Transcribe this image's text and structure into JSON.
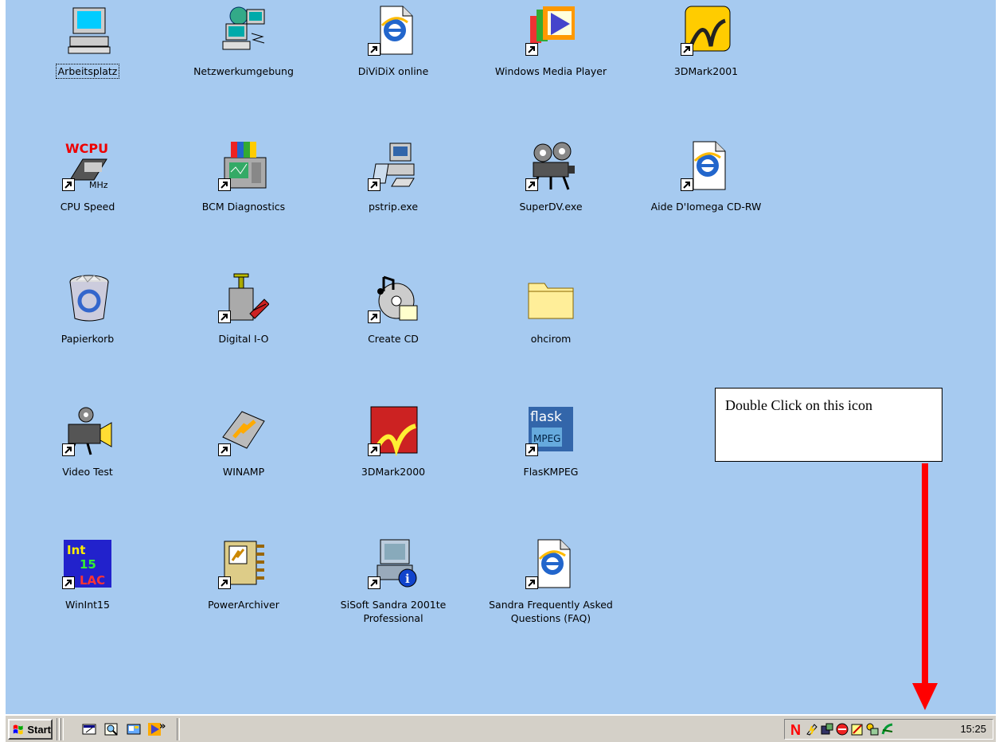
{
  "desktop": {
    "background": "#a6caf0",
    "icons": [
      {
        "label": "Arbeitsplatz",
        "icon": "my-computer-icon",
        "shortcut": false,
        "selected": true
      },
      {
        "label": "Netzwerkumgebung",
        "icon": "network-neighborhood-icon",
        "shortcut": false
      },
      {
        "label": "DiViDiX online",
        "icon": "internet-explorer-document-icon",
        "shortcut": true
      },
      {
        "label": "Windows Media Player",
        "icon": "media-player-icon",
        "shortcut": true
      },
      {
        "label": "3DMark2001",
        "icon": "3dmark2001-icon",
        "shortcut": true
      },
      {
        "label": "CPU Speed",
        "icon": "wcpu-icon",
        "shortcut": true
      },
      {
        "label": "BCM Diagnostics",
        "icon": "bcm-diagnostics-icon",
        "shortcut": true
      },
      {
        "label": "pstrip.exe",
        "icon": "pstrip-computer-icon",
        "shortcut": true
      },
      {
        "label": "SuperDV.exe",
        "icon": "film-projector-icon",
        "shortcut": true
      },
      {
        "label": "Aide D'Iomega CD-RW",
        "icon": "internet-explorer-document-icon",
        "shortcut": true
      },
      {
        "label": "Papierkorb",
        "icon": "recycle-bin-icon",
        "shortcut": false
      },
      {
        "label": "Digital I-O",
        "icon": "dynamite-plunger-icon",
        "shortcut": true
      },
      {
        "label": "Create CD",
        "icon": "cd-music-icon",
        "shortcut": true
      },
      {
        "label": "ohcirom",
        "icon": "folder-icon",
        "shortcut": false
      },
      {
        "label": "Video Test",
        "icon": "video-camera-icon",
        "shortcut": true
      },
      {
        "label": "WINAMP",
        "icon": "winamp-bolt-icon",
        "shortcut": true
      },
      {
        "label": "3DMark2000",
        "icon": "3dmark2000-icon",
        "shortcut": true
      },
      {
        "label": "FlasKMPEG",
        "icon": "flask-mpeg-icon",
        "shortcut": true
      },
      {
        "label": "WinInt15",
        "icon": "winint15-icon",
        "shortcut": true
      },
      {
        "label": "PowerArchiver",
        "icon": "powerarchiver-icon",
        "shortcut": true
      },
      {
        "label": "SiSoft Sandra 2001te\nProfessional",
        "icon": "sandra-computer-info-icon",
        "shortcut": true
      },
      {
        "label": "Sandra Frequently Asked\nQuestions (FAQ)",
        "icon": "internet-explorer-document-icon",
        "shortcut": true
      }
    ]
  },
  "callout": {
    "text": "Double Click on this icon",
    "arrow_color": "#ff0000"
  },
  "taskbar": {
    "start_label": "Start",
    "quicklaunch": [
      "desktop-icon",
      "search-icon",
      "channels-icon",
      "media-player-icon"
    ],
    "chevron": "»",
    "tray_icons": [
      "norton-n-icon",
      "power-icon",
      "network-icon",
      "antivirus-icon",
      "notepad-icon",
      "display-icon",
      "sisoft-sandra-tray-icon"
    ],
    "clock": "15:25"
  },
  "colors": {
    "taskbar": "#d4d0c8",
    "norton": "#ff0000"
  }
}
